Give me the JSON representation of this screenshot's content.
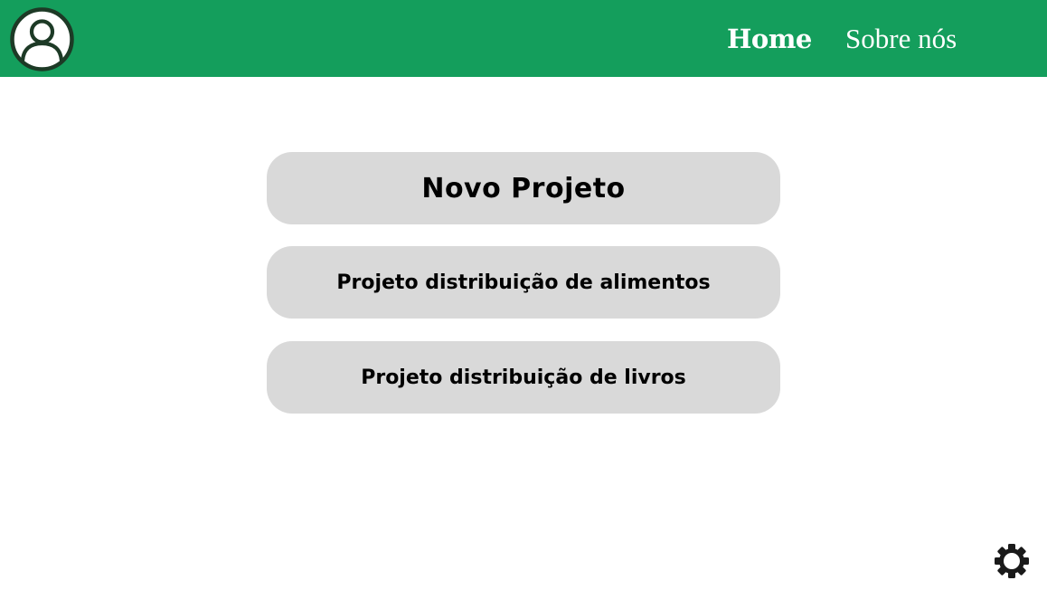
{
  "header": {
    "background_color": "#149e5c",
    "avatar_icon": "user-circle-icon",
    "nav": [
      {
        "label": "Home",
        "active": true
      },
      {
        "label": "Sobre nós",
        "active": false
      }
    ]
  },
  "main": {
    "button_color": "#d9d9d9",
    "projects": [
      {
        "label": "Novo Projeto"
      },
      {
        "label": "Projeto distribuição de alimentos"
      },
      {
        "label": "Projeto distribuição de livros"
      }
    ]
  },
  "footer": {
    "settings_icon": "gear-icon"
  }
}
